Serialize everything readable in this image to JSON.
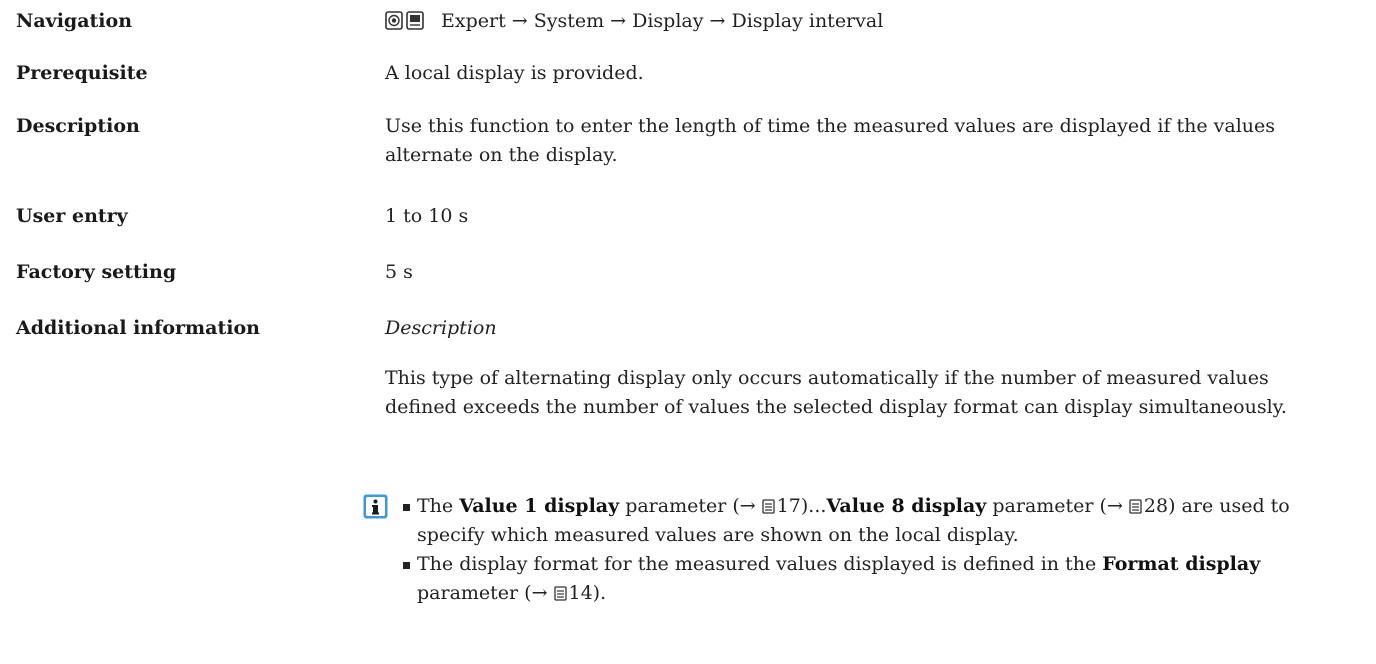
{
  "rows": {
    "navigation": {
      "label": "Navigation",
      "path": "Expert → System → Display → Display interval"
    },
    "prerequisite": {
      "label": "Prerequisite",
      "value": "A local display is provided."
    },
    "description": {
      "label": "Description",
      "value": "Use this function to enter the length of time the measured values are displayed if the values alternate on the display."
    },
    "user_entry": {
      "label": "User entry",
      "value": "1 to 10 s"
    },
    "factory_setting": {
      "label": "Factory setting",
      "value": "5 s"
    },
    "additional_information": {
      "label": "Additional information",
      "subheading": "Description",
      "paragraph": "This type of alternating display only occurs automatically if the number of measured values defined exceeds the number of values the selected display format can display simultaneously."
    }
  },
  "tip": {
    "icon": "info-icon",
    "item1": {
      "bold1": "Value 1 display",
      "text1": "parameter (→",
      "page1": "17)...",
      "bold2": "Value 8 display",
      "text2": "parameter (→",
      "page2": "28)",
      "text3": "are used to specify which measured values are shown on the local display."
    },
    "item2": {
      "text1": "The display format for the measured values displayed is defined in the",
      "bold1": "Format display",
      "text2": "parameter (→",
      "page1": "14)."
    }
  },
  "colors": {
    "info_icon": "#3a9ad9",
    "text": "#1a1a1a"
  }
}
